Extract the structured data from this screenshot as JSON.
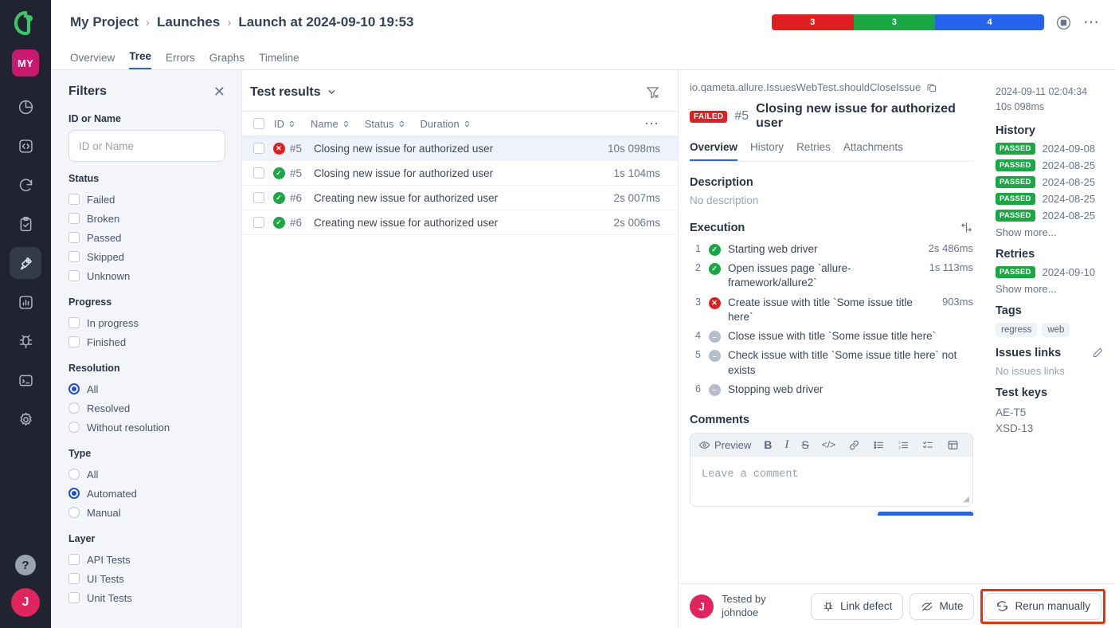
{
  "rail": {
    "logo": "allure-logo",
    "project_badge": "MY",
    "items": [
      {
        "name": "dashboard",
        "icon": "pie-chart-icon"
      },
      {
        "name": "code",
        "icon": "code-brackets-icon"
      },
      {
        "name": "sync",
        "icon": "refresh-icon"
      },
      {
        "name": "test-cases",
        "icon": "clipboard-check-icon"
      },
      {
        "name": "launches",
        "icon": "rocket-icon",
        "active": true
      },
      {
        "name": "analytics",
        "icon": "bar-chart-icon"
      },
      {
        "name": "defects",
        "icon": "bug-icon"
      },
      {
        "name": "console",
        "icon": "terminal-icon"
      },
      {
        "name": "settings",
        "icon": "gear-icon"
      }
    ],
    "help_label": "?",
    "avatar_initial": "J"
  },
  "header": {
    "breadcrumbs": [
      {
        "label": "My Project"
      },
      {
        "label": "Launches"
      },
      {
        "label": "Launch at 2024-09-10 19:53"
      }
    ],
    "separator": "›",
    "status_bar": [
      {
        "label": "3",
        "color": "#e02020",
        "status": "failed"
      },
      {
        "label": "3",
        "color": "#1aa845",
        "status": "passed"
      },
      {
        "label": "4",
        "color": "#2563eb",
        "status": "skipped"
      }
    ],
    "stop_icon": "stop-circle-icon",
    "more_icon": "more-options-icon",
    "tabs": [
      {
        "label": "Overview",
        "active": false
      },
      {
        "label": "Tree",
        "active": true
      },
      {
        "label": "Errors",
        "active": false
      },
      {
        "label": "Graphs",
        "active": false
      },
      {
        "label": "Timeline",
        "active": false
      }
    ]
  },
  "filters": {
    "title": "Filters",
    "close_icon": "close-icon",
    "id_or_name": {
      "label": "ID or Name",
      "placeholder": "ID or Name",
      "value": ""
    },
    "groups": [
      {
        "label": "Status",
        "type": "checkbox",
        "options": [
          {
            "label": "Failed",
            "checked": false
          },
          {
            "label": "Broken",
            "checked": false
          },
          {
            "label": "Passed",
            "checked": false
          },
          {
            "label": "Skipped",
            "checked": false
          },
          {
            "label": "Unknown",
            "checked": false
          }
        ]
      },
      {
        "label": "Progress",
        "type": "checkbox",
        "options": [
          {
            "label": "In progress",
            "checked": false
          },
          {
            "label": "Finished",
            "checked": false
          }
        ]
      },
      {
        "label": "Resolution",
        "type": "radio",
        "options": [
          {
            "label": "All",
            "checked": true
          },
          {
            "label": "Resolved",
            "checked": false
          },
          {
            "label": "Without resolution",
            "checked": false
          }
        ]
      },
      {
        "label": "Type",
        "type": "radio",
        "options": [
          {
            "label": "All",
            "checked": false
          },
          {
            "label": "Automated",
            "checked": true
          },
          {
            "label": "Manual",
            "checked": false
          }
        ]
      },
      {
        "label": "Layer",
        "type": "checkbox",
        "options": [
          {
            "label": "API Tests",
            "checked": false
          },
          {
            "label": "UI Tests",
            "checked": false
          },
          {
            "label": "Unit Tests",
            "checked": false
          }
        ]
      }
    ]
  },
  "results": {
    "title": "Test results",
    "chevron_icon": "chevron-down-icon",
    "clear_filter_icon": "filter-clear-icon",
    "more_icon": "more-options-icon",
    "columns": [
      {
        "label": "ID",
        "sortable": true
      },
      {
        "label": "Name",
        "sortable": true
      },
      {
        "label": "Status",
        "sortable": true
      },
      {
        "label": "Duration",
        "sortable": true
      }
    ],
    "rows": [
      {
        "id": "#5",
        "status": "failed",
        "name": "Closing new issue for authorized user",
        "duration": "10s 098ms",
        "selected": true
      },
      {
        "id": "#5",
        "status": "passed",
        "name": "Closing new issue for authorized user",
        "duration": "1s 104ms",
        "selected": false
      },
      {
        "id": "#6",
        "status": "passed",
        "name": "Creating new issue for authorized user",
        "duration": "2s 007ms",
        "selected": false
      },
      {
        "id": "#6",
        "status": "passed",
        "name": "Creating new issue for authorized user",
        "duration": "2s 006ms",
        "selected": false
      }
    ]
  },
  "detail": {
    "fqn": "io.qameta.allure.IssuesWebTest.shouldCloseIssue",
    "copy_icon": "copy-icon",
    "status_badge": "FAILED",
    "test_number": "#5",
    "test_title": "Closing new issue for authorized user",
    "tabs": [
      {
        "label": "Overview",
        "active": true
      },
      {
        "label": "History",
        "active": false
      },
      {
        "label": "Retries",
        "active": false
      },
      {
        "label": "Attachments",
        "active": false
      }
    ],
    "description": {
      "heading": "Description",
      "text": "No description"
    },
    "execution": {
      "heading": "Execution",
      "compare_icon": "compare-icon",
      "steps": [
        {
          "n": "1",
          "status": "passed",
          "text": "Starting web driver",
          "duration": "2s 486ms"
        },
        {
          "n": "2",
          "status": "passed",
          "text": "Open issues page `allure-framework/allure2`",
          "duration": "1s 113ms"
        },
        {
          "n": "3",
          "status": "failed",
          "text": "Create issue with title `Some issue title here`",
          "duration": "903ms"
        },
        {
          "n": "4",
          "status": "skipped",
          "text": "Close issue with title `Some issue title here`",
          "duration": ""
        },
        {
          "n": "5",
          "status": "skipped",
          "text": "Check issue with title `Some issue title here` not exists",
          "duration": ""
        },
        {
          "n": "6",
          "status": "skipped",
          "text": "Stopping web driver",
          "duration": ""
        }
      ]
    },
    "comments": {
      "heading": "Comments",
      "preview_label": "Preview",
      "preview_icon": "eye-icon",
      "toolbar": [
        {
          "name": "bold",
          "glyph": "B"
        },
        {
          "name": "italic",
          "glyph": "I"
        },
        {
          "name": "strikethrough",
          "glyph": "S"
        },
        {
          "name": "code",
          "glyph": "</>"
        },
        {
          "name": "link",
          "glyph": "link-icon"
        },
        {
          "name": "bullet-list",
          "glyph": "bullet-list-icon"
        },
        {
          "name": "ordered-list",
          "glyph": "ordered-list-icon"
        },
        {
          "name": "task-list",
          "glyph": "task-list-icon"
        },
        {
          "name": "table",
          "glyph": "table-icon"
        }
      ],
      "placeholder": "Leave a comment",
      "value": ""
    }
  },
  "meta": {
    "timestamp": "2024-09-11 02:04:34",
    "duration": "10s 098ms",
    "history": {
      "heading": "History",
      "entries": [
        {
          "status": "PASSED",
          "date": "2024-09-08"
        },
        {
          "status": "PASSED",
          "date": "2024-08-25"
        },
        {
          "status": "PASSED",
          "date": "2024-08-25"
        },
        {
          "status": "PASSED",
          "date": "2024-08-25"
        },
        {
          "status": "PASSED",
          "date": "2024-08-25"
        }
      ],
      "show_more": "Show more..."
    },
    "retries": {
      "heading": "Retries",
      "entries": [
        {
          "status": "PASSED",
          "date": "2024-09-10"
        }
      ],
      "show_more": "Show more..."
    },
    "tags": {
      "heading": "Tags",
      "items": [
        "regress",
        "web"
      ]
    },
    "issues_links": {
      "heading": "Issues links",
      "edit_icon": "pencil-icon",
      "empty_text": "No issues links"
    },
    "test_keys": {
      "heading": "Test keys",
      "items": [
        "AE-T5",
        "XSD-13"
      ]
    }
  },
  "footer": {
    "tested_by_avatar": "J",
    "tested_by_label": "Tested by",
    "tested_by_user": "johndoe",
    "buttons": [
      {
        "label": "Link defect",
        "icon": "bug-icon",
        "highlighted": false
      },
      {
        "label": "Mute",
        "icon": "mute-eye-icon",
        "highlighted": false
      },
      {
        "label": "Rerun manually",
        "icon": "rerun-icon",
        "highlighted": true
      }
    ],
    "highlight_color": "#e8340c"
  }
}
